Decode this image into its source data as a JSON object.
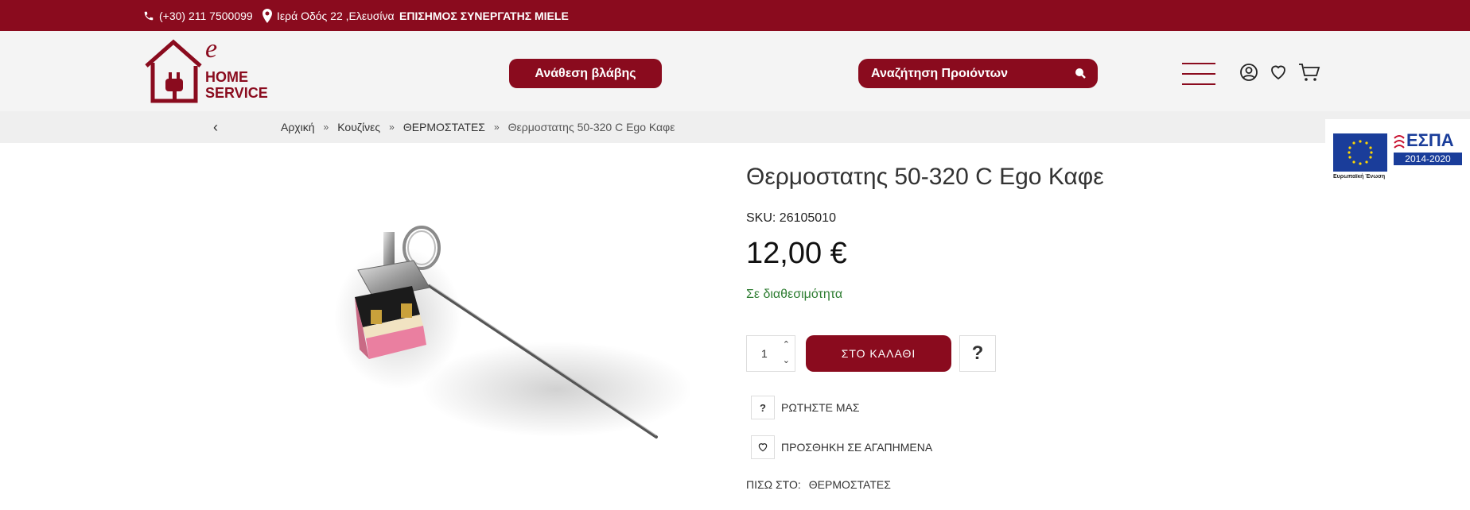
{
  "topbar": {
    "phone": "(+30) 211 7500099",
    "address": "Ιερά Οδός 22 ,Ελευσίνα",
    "partner": "ΕΠΙΣΗΜΟΣ ΣΥΝΕΡΓΑΤΗΣ MIELE"
  },
  "header": {
    "logo_e": "e",
    "logo_line1": "HOME",
    "logo_line2": "SERVICE",
    "repair_button": "Ανάθεση βλάβης",
    "search_label": "Αναζήτηση Προιόντων"
  },
  "breadcrumb": {
    "items": [
      "Αρχική",
      "Κουζίνες",
      "ΘΕΡΜΟΣΤΑΤΕΣ"
    ],
    "current": "Θερμοστατης 50-320 C Ego Καφε"
  },
  "product": {
    "title": "Θερμοστατης 50-320 C Ego Καφε",
    "sku": "SKU: 26105010",
    "price": "12,00 €",
    "stock": "Σε διαθεσιμότητα",
    "quantity": "1",
    "add_to_cart": "ΣΤΟ ΚΑΛΑΘΙ",
    "question_mark": "?",
    "ask_label": "ΡΩΤΗΣΤΕ ΜΑΣ",
    "favorite_label": "ΠΡΟΣΘΗΚΗ ΣΕ ΑΓΑΠΗΜΕΝΑ",
    "back_to_label": "ΠΙΣΩ ΣΤΟ:",
    "back_to_link": "ΘΕΡΜΟΣΤΑΤΕΣ"
  },
  "espa": {
    "brand": "ΕΣΠΑ",
    "years": "2014-2020",
    "eu_label": "Ευρωπαϊκή Ένωση"
  },
  "colors": {
    "brand": "#8a0b1e",
    "stock": "#2e7d32",
    "header_bg": "#f4f4f4"
  }
}
